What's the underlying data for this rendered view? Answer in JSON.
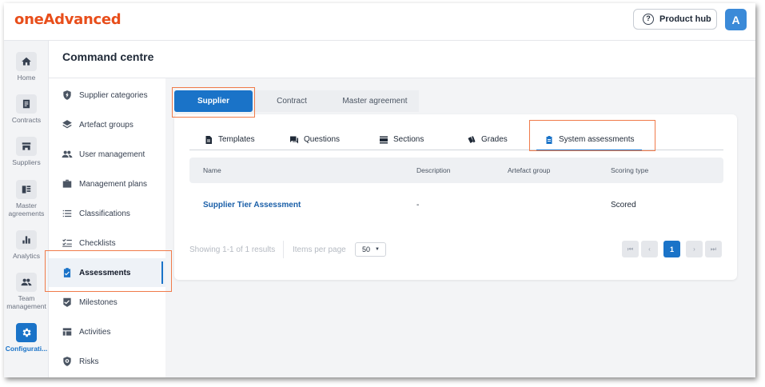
{
  "brand": {
    "logo_text": "oneAdvanced",
    "accent": "#e84e1b",
    "primary": "#1a73c8"
  },
  "topbar": {
    "product_hub_label": "Product hub",
    "product_hub_icon": "help-circle-icon",
    "avatar_letter": "A"
  },
  "rail": {
    "items": [
      {
        "label": "Home",
        "icon": "home-icon"
      },
      {
        "label": "Contracts",
        "icon": "document-icon"
      },
      {
        "label": "Suppliers",
        "icon": "store-icon"
      },
      {
        "label": "Master agreements",
        "icon": "list-icon"
      },
      {
        "label": "Analytics",
        "icon": "bar-chart-icon"
      },
      {
        "label": "Team management",
        "icon": "people-icon"
      },
      {
        "label": "Configurati...",
        "icon": "gear-icon",
        "active": true
      }
    ]
  },
  "header": {
    "title": "Command centre"
  },
  "subnav": {
    "items": [
      {
        "label": "Supplier categories",
        "icon": "shield-icon"
      },
      {
        "label": "Artefact groups",
        "icon": "layers-icon"
      },
      {
        "label": "User management",
        "icon": "people-icon"
      },
      {
        "label": "Management plans",
        "icon": "briefcase-icon"
      },
      {
        "label": "Classifications",
        "icon": "list-icon"
      },
      {
        "label": "Checklists",
        "icon": "checklist-icon"
      },
      {
        "label": "Assessments",
        "icon": "clipboard-check-icon",
        "active": true
      },
      {
        "label": "Milestones",
        "icon": "milestone-icon"
      },
      {
        "label": "Activities",
        "icon": "table-icon"
      },
      {
        "label": "Risks",
        "icon": "risk-icon"
      }
    ]
  },
  "top_tabs": [
    {
      "label": "Supplier",
      "active": true
    },
    {
      "label": "Contract"
    },
    {
      "label": "Master agreement"
    }
  ],
  "inner_tabs": [
    {
      "label": "Templates",
      "icon": "document-icon"
    },
    {
      "label": "Questions",
      "icon": "chat-icon"
    },
    {
      "label": "Sections",
      "icon": "sections-icon"
    },
    {
      "label": "Grades",
      "icon": "cards-icon"
    },
    {
      "label": "System assessments",
      "icon": "clipboard-icon",
      "active": true
    }
  ],
  "table": {
    "columns": [
      "Name",
      "Description",
      "Artefact group",
      "Scoring type"
    ],
    "rows": [
      {
        "name": "Supplier Tier Assessment",
        "description": "-",
        "artefact_group": "",
        "scoring_type": "Scored"
      }
    ]
  },
  "pagination": {
    "summary": "Showing 1-1 of 1 results",
    "per_page_label": "Items per page",
    "per_page_value": "50",
    "first": "⏮",
    "prev": "‹",
    "current_page": "1",
    "next": "›",
    "last": "⏭"
  }
}
